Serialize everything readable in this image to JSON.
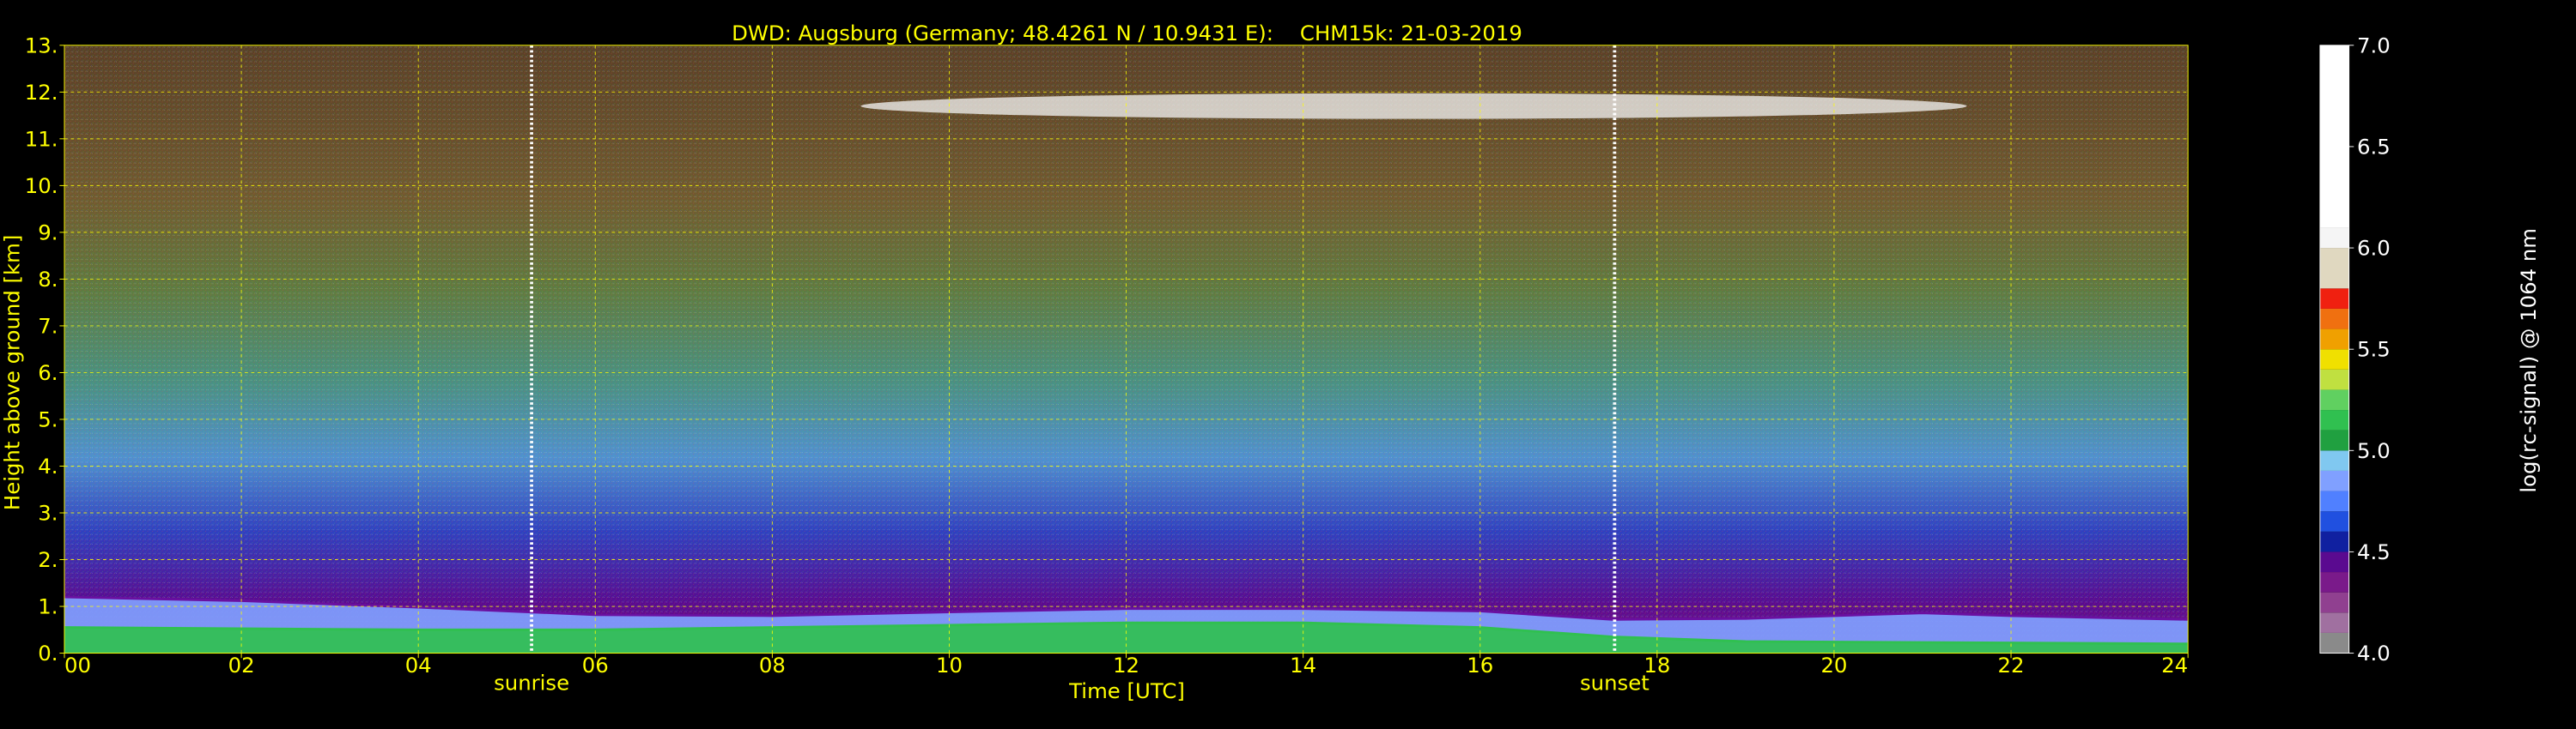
{
  "chart_data": {
    "type": "heatmap",
    "title": "DWD: Augsburg (Germany; 48.4261 N / 10.9431 E):    CHM15k: 21-03-2019",
    "xlabel": "Time [UTC]",
    "ylabel": "Height above ground [km]",
    "xlim": [
      0,
      24
    ],
    "ylim": [
      0,
      13
    ],
    "x_ticks": [
      0,
      2,
      4,
      6,
      8,
      10,
      12,
      14,
      16,
      18,
      20,
      22,
      24
    ],
    "x_tick_labels": [
      "00",
      "02",
      "04",
      "06",
      "08",
      "10",
      "12",
      "14",
      "16",
      "18",
      "20",
      "22",
      "24"
    ],
    "y_ticks": [
      0,
      1,
      2,
      3,
      4,
      5,
      6,
      7,
      8,
      9,
      10,
      11,
      12,
      13
    ],
    "y_tick_labels": [
      "0.",
      "1.",
      "2.",
      "3.",
      "4.",
      "5.",
      "6.",
      "7.",
      "8.",
      "9.",
      "10.",
      "11.",
      "12.",
      "13."
    ],
    "grid": true,
    "colorbar": {
      "label": "log(rc-signal) @ 1064 nm",
      "range": [
        4.0,
        7.0
      ],
      "ticks": [
        4.0,
        4.5,
        5.0,
        5.5,
        6.0,
        6.5,
        7.0
      ],
      "tick_labels": [
        "4.0",
        "4.5",
        "5.0",
        "5.5",
        "6.0",
        "6.5",
        "7.0"
      ],
      "levels": [
        {
          "value": 4.0,
          "color": "#8a8a8a"
        },
        {
          "value": 4.1,
          "color": "#a070a0"
        },
        {
          "value": 4.2,
          "color": "#904090"
        },
        {
          "value": 4.3,
          "color": "#7a1a8a"
        },
        {
          "value": 4.4,
          "color": "#5a0a90"
        },
        {
          "value": 4.5,
          "color": "#1020a0"
        },
        {
          "value": 4.6,
          "color": "#2050e0"
        },
        {
          "value": 4.7,
          "color": "#5080ff"
        },
        {
          "value": 4.8,
          "color": "#80a0ff"
        },
        {
          "value": 4.9,
          "color": "#80c8f0"
        },
        {
          "value": 5.0,
          "color": "#20a040"
        },
        {
          "value": 5.1,
          "color": "#30c050"
        },
        {
          "value": 5.2,
          "color": "#60d060"
        },
        {
          "value": 5.3,
          "color": "#c0e040"
        },
        {
          "value": 5.4,
          "color": "#f0e000"
        },
        {
          "value": 5.5,
          "color": "#f0a000"
        },
        {
          "value": 5.6,
          "color": "#f07010"
        },
        {
          "value": 5.7,
          "color": "#f02010"
        },
        {
          "value": 5.8,
          "color": "#e0d8c0"
        },
        {
          "value": 6.0,
          "color": "#f5f5f5"
        },
        {
          "value": 6.1,
          "color": "#ffffff"
        }
      ]
    },
    "annotations": [
      {
        "text": "sunrise",
        "x": 5.28
      },
      {
        "text": "sunset",
        "x": 17.52
      }
    ],
    "layers": [
      {
        "feature": "aerosol boundary layer",
        "top_km": [
          [
            0,
            1.2
          ],
          [
            2,
            1.12
          ],
          [
            4,
            0.98
          ],
          [
            6,
            0.82
          ],
          [
            8,
            0.8
          ],
          [
            10,
            0.88
          ],
          [
            12,
            0.95
          ],
          [
            14,
            0.95
          ],
          [
            16,
            0.9
          ],
          [
            17.5,
            0.72
          ],
          [
            19,
            0.74
          ],
          [
            21,
            0.86
          ],
          [
            22,
            0.8
          ],
          [
            24,
            0.72
          ]
        ],
        "value": 4.8
      },
      {
        "feature": "dense low aerosol",
        "top_km": [
          [
            0,
            0.55
          ],
          [
            4,
            0.5
          ],
          [
            6,
            0.5
          ],
          [
            8,
            0.55
          ],
          [
            10,
            0.6
          ],
          [
            12,
            0.65
          ],
          [
            14,
            0.65
          ],
          [
            16,
            0.55
          ],
          [
            17.5,
            0.35
          ],
          [
            19,
            0.25
          ],
          [
            24,
            0.2
          ]
        ],
        "value": 5.1
      },
      {
        "feature": "cirrus cloud",
        "x_start": 9.0,
        "x_end": 21.5,
        "height_km": 11.7,
        "thickness_km": 0.55,
        "value": 6.0
      }
    ]
  },
  "colors": {
    "background": "#000000",
    "text": "#ffff00",
    "grid": "#ffff00",
    "sun_line": "#ffffff"
  }
}
